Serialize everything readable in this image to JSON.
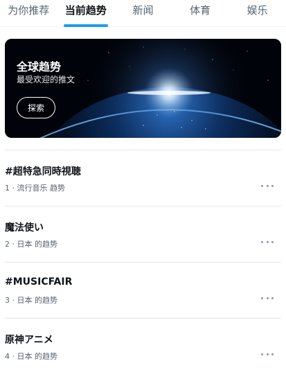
{
  "tabs": [
    {
      "label": "为你推荐",
      "active": false
    },
    {
      "label": "当前趋势",
      "active": true
    },
    {
      "label": "新闻",
      "active": false
    },
    {
      "label": "体育",
      "active": false
    },
    {
      "label": "娱乐",
      "active": false
    }
  ],
  "hero": {
    "title": "全球趋势",
    "subtitle": "最受欢迎的推文",
    "button_label": "探索"
  },
  "trends": [
    {
      "name": "#超特急同時視聴",
      "meta": "1 · 流行音乐 趋势"
    },
    {
      "name": "魔法使い",
      "meta": "2 · 日本 的趋势"
    },
    {
      "name": "#MUSICFAIR",
      "meta": "3 · 日本 的趋势"
    },
    {
      "name": "原神アニメ",
      "meta": "4 · 日本 的趋势"
    }
  ],
  "icons": {
    "more": "more-horizontal-icon"
  },
  "colors": {
    "accent": "#1d9bf0",
    "text_primary": "#0f1419",
    "text_secondary": "#536471"
  }
}
